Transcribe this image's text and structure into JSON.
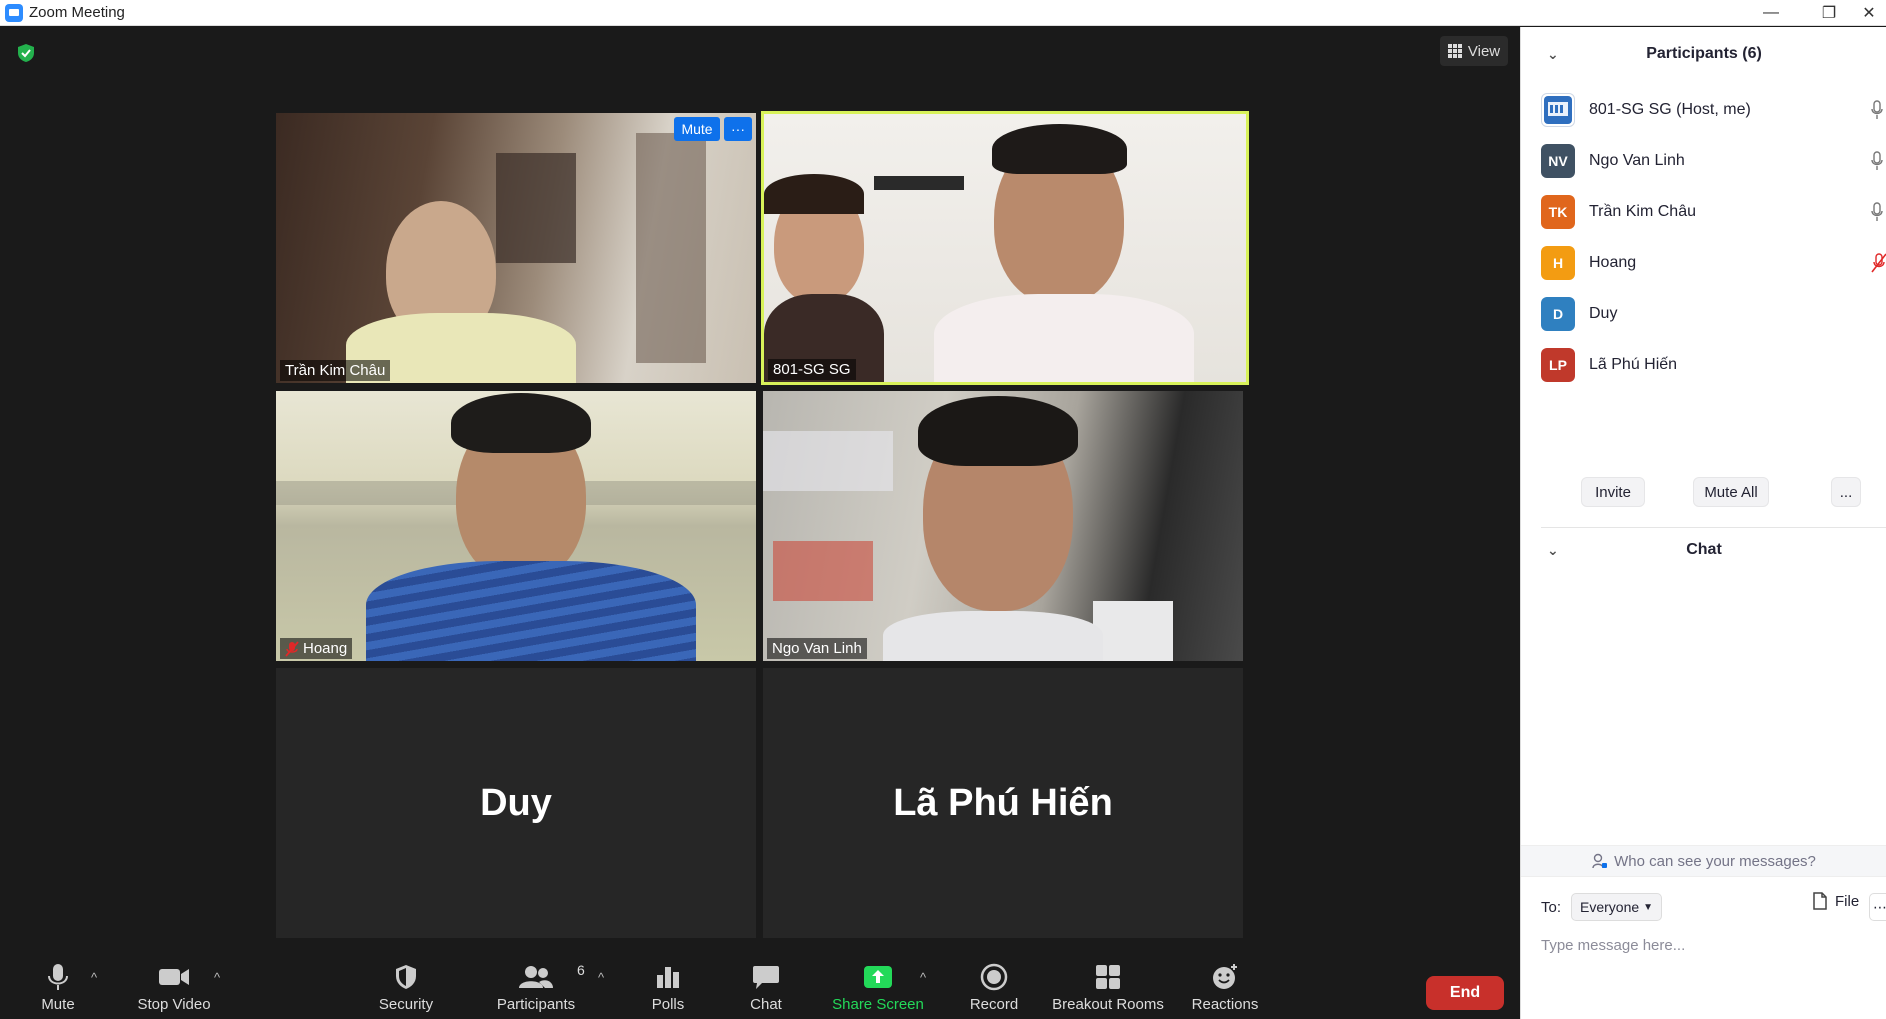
{
  "window": {
    "title": "Zoom Meeting",
    "minimize_glyph": "—",
    "restore_glyph": "❐",
    "close_glyph": "✕"
  },
  "stage": {
    "view_label": "View",
    "tiles": [
      {
        "name": "Trần Kim Châu",
        "video": true,
        "muted": false,
        "active_speaker": false
      },
      {
        "name": "801-SG SG",
        "video": true,
        "muted": false,
        "active_speaker": true
      },
      {
        "name": "Hoang",
        "video": true,
        "muted": true,
        "active_speaker": false
      },
      {
        "name": "Ngo Van Linh",
        "video": true,
        "muted": false,
        "active_speaker": false
      },
      {
        "name": "Duy",
        "video": false,
        "muted": false,
        "active_speaker": false
      },
      {
        "name": "Lã Phú Hiến",
        "video": false,
        "muted": false,
        "active_speaker": false
      }
    ],
    "hover_mute_label": "Mute",
    "hover_more_label": "···"
  },
  "toolbar": {
    "mute": "Mute",
    "stop_video": "Stop Video",
    "security": "Security",
    "participants": "Participants",
    "participants_count": "6",
    "polls": "Polls",
    "chat": "Chat",
    "share_screen": "Share Screen",
    "record": "Record",
    "breakout_rooms": "Breakout Rooms",
    "reactions": "Reactions",
    "end": "End",
    "caret": "^"
  },
  "participants_panel": {
    "title": "Participants (6)",
    "list": [
      {
        "initials": "",
        "name": "801-SG SG (Host, me)",
        "color": "#2f6fbf",
        "mic": "on"
      },
      {
        "initials": "NV",
        "name": "Ngo Van Linh",
        "color": "#3f5163",
        "mic": "on"
      },
      {
        "initials": "TK",
        "name": "Trần Kim Châu",
        "color": "#e0661c",
        "mic": "on"
      },
      {
        "initials": "H",
        "name": "Hoang",
        "color": "#f39c12",
        "mic": "muted"
      },
      {
        "initials": "D",
        "name": "Duy",
        "color": "#2f80c0",
        "mic": "none"
      },
      {
        "initials": "LP",
        "name": "Lã Phú Hiến",
        "color": "#c0392b",
        "mic": "none"
      }
    ],
    "invite": "Invite",
    "mute_all": "Mute All",
    "more": "..."
  },
  "chat_panel": {
    "title": "Chat",
    "who_can_see": "Who can see your messages?",
    "to_label": "To:",
    "recipient": "Everyone",
    "file": "File",
    "placeholder": "Type message here...",
    "more": "⋯"
  },
  "colors": {
    "accent": "#0e71eb",
    "speaker_border": "#d8f25a",
    "share_green": "#23d959",
    "end_red": "#c8302b",
    "muted_red": "#e02828"
  }
}
